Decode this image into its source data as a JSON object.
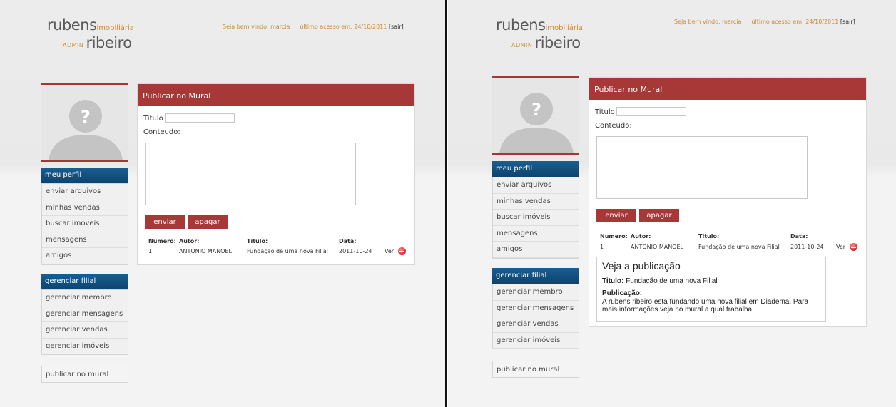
{
  "header": {
    "logo_main": "rubens",
    "logo_sub": "imobiliária",
    "logo_admin": "ADMIN",
    "logo_second": "ribeiro",
    "welcome": "Seja bem vindo, marcia",
    "last_access": "último acesso em: 24/10/2011",
    "logout": "[sair]"
  },
  "sidebar": {
    "profile_header": "meu perfil",
    "profile_items": [
      "enviar arquivos",
      "minhas vendas",
      "buscar imóveis",
      "mensagens",
      "amigos"
    ],
    "branch_header": "gerenciar filial",
    "branch_items": [
      "gerenciar membro",
      "gerenciar mensagens",
      "gerenciar vendas",
      "gerenciar imóveis"
    ],
    "publish": "publicar no mural"
  },
  "mural": {
    "title": "Publicar no Mural",
    "titulo_label": "Titulo",
    "titulo_value": "",
    "conteudo_label": "Conteudo:",
    "conteudo_value": "",
    "send_button": "enviar",
    "clear_button": "apagar",
    "columns": [
      "Numero:",
      "Autor:",
      "Titulo:",
      "Data:"
    ],
    "rows": [
      {
        "numero": "1",
        "autor": "ANTONIO MANOEL",
        "titulo": "Fundação de uma nova Filial",
        "data": "2011-10-24",
        "action": "Ver"
      }
    ]
  },
  "publication_popup": {
    "heading": "Veja a publicação",
    "titulo_label": "Titulo:",
    "titulo_value": "Fundação de uma nova Filial",
    "publicacao_label": "Publicação:",
    "publicacao_text": "A rubens ribeiro esta fundando uma nova filial em Diadema. Para mais informações veja no mural a qual trabalha."
  },
  "colors": {
    "accent_red": "#a63838",
    "menu_blue": "#0d4470",
    "logo_orange": "#d18a2c"
  },
  "icons": {
    "avatar": "user-silhouette-question-icon",
    "delete": "delete-minus-icon"
  }
}
